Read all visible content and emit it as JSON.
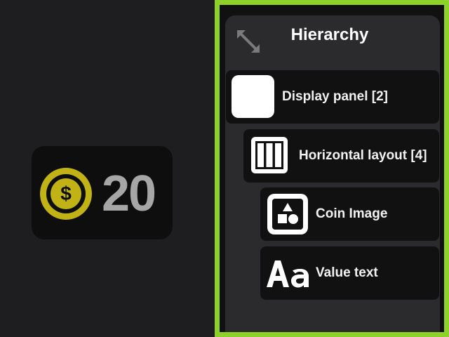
{
  "widget": {
    "coin_value": "20",
    "coin_color": "#c1b315",
    "value_color": "#a6a6a6"
  },
  "hierarchy": {
    "title": "Hierarchy",
    "accent_color": "#8fd12b",
    "items": [
      {
        "label": "Display panel [2]",
        "icon": "white-square-icon",
        "depth": 0
      },
      {
        "label": "Horizontal layout [4]",
        "icon": "columns-layout-icon",
        "depth": 1
      },
      {
        "label": "Coin Image",
        "icon": "shapes-image-icon",
        "depth": 2
      },
      {
        "label": "Value text",
        "icon": "text-aa-icon",
        "depth": 2
      }
    ]
  }
}
